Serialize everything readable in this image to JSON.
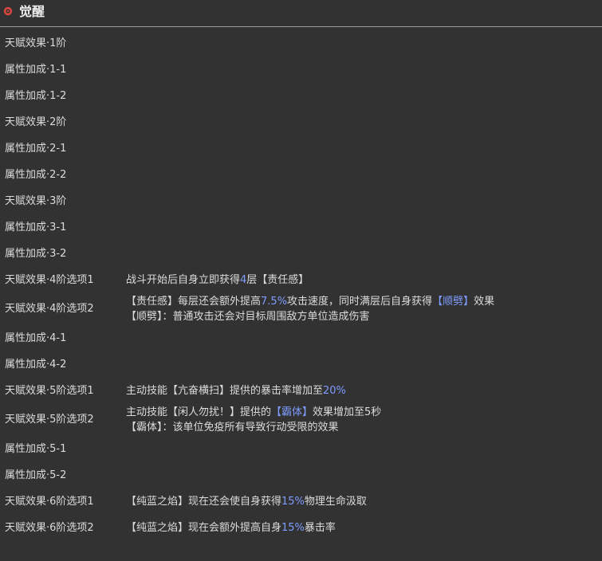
{
  "header": {
    "title": "觉醒",
    "icon": "gear-icon",
    "icon_color": "#d8443e"
  },
  "colors": {
    "background": "#323232",
    "text": "#dcdcdc",
    "highlight": "#7f9cff"
  },
  "rows": [
    {
      "label": "天赋效果·1阶"
    },
    {
      "label": "属性加成·1-1"
    },
    {
      "label": "属性加成·1-2"
    },
    {
      "label": "天赋效果·2阶"
    },
    {
      "label": "属性加成·2-1"
    },
    {
      "label": "属性加成·2-2"
    },
    {
      "label": "天赋效果·3阶"
    },
    {
      "label": "属性加成·3-1"
    },
    {
      "label": "属性加成·3-2"
    },
    {
      "label": "天赋效果·4阶选项1",
      "desc": {
        "a": "战斗开始后自身立即获得",
        "b": "4",
        "c": "层【责任感】"
      }
    },
    {
      "label": "天赋效果·4阶选项2",
      "desc1": {
        "a": "【责任感】每层还会额外提高",
        "b": "7.5%",
        "c": "攻击速度，同时满层后自身获得",
        "d": "【顺劈】",
        "e": "效果"
      },
      "desc2": "【顺劈】：普通攻击还会对目标周围敌方单位造成伤害"
    },
    {
      "label": "属性加成·4-1"
    },
    {
      "label": "属性加成·4-2"
    },
    {
      "label": "天赋效果·5阶选项1",
      "desc": {
        "a": "主动技能【亢奋横扫】提供的暴击率增加至",
        "b": "20%"
      }
    },
    {
      "label": "天赋效果·5阶选项2",
      "desc1": {
        "a": "主动技能【闲人勿扰！】提供的",
        "b": "【霸体】",
        "c": "效果增加至5秒"
      },
      "desc2": "【霸体】：该单位免疫所有导致行动受限的效果"
    },
    {
      "label": "属性加成·5-1"
    },
    {
      "label": "属性加成·5-2"
    },
    {
      "label": "天赋效果·6阶选项1",
      "desc": {
        "a": "【纯蓝之焰】现在还会使自身获得",
        "b": "15%",
        "c": "物理生命汲取"
      }
    },
    {
      "label": "天赋效果·6阶选项2",
      "desc": {
        "a": "【纯蓝之焰】现在会额外提高自身",
        "b": "15%",
        "c": "暴击率"
      }
    }
  ]
}
